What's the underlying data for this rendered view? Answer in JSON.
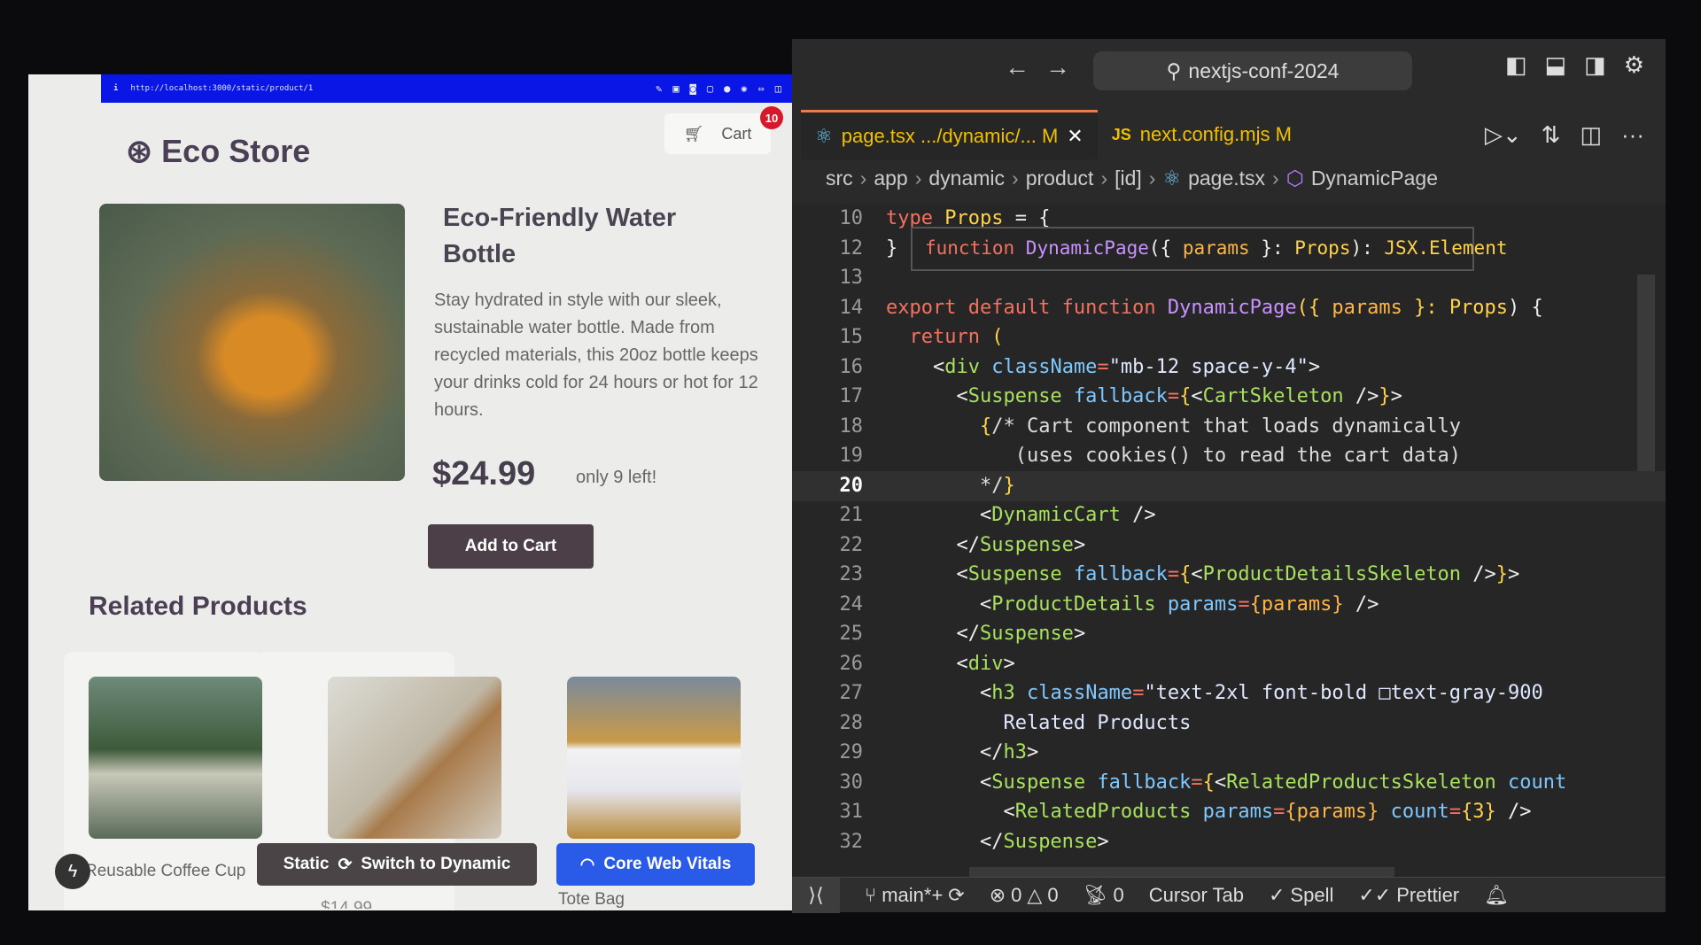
{
  "browser": {
    "url": "http://localhost:3000/static/product/1",
    "toolbar_icons": [
      "pin-icon",
      "contacts-icon",
      "camera-icon",
      "window-icon",
      "globe-icon",
      "settings-icon",
      "sync-icon",
      "sidebar-icon"
    ],
    "store_name": "Eco Store",
    "cart_label": "Cart",
    "cart_count": "10",
    "product": {
      "title": "Eco-Friendly Water Bottle",
      "description": "Stay hydrated in style with our sleek, sustainable water bottle. Made from recycled materials, this 20oz bottle keeps your drinks cold for 24 hours or hot for 12 hours.",
      "price": "$24.99",
      "stock": "only 9 left!",
      "add_to_cart": "Add to Cart"
    },
    "related_title": "Related Products",
    "related": [
      {
        "name": "Reusable Coffee Cup"
      },
      {
        "name": "",
        "price": "$14.99"
      },
      {
        "name": "Tote Bag"
      }
    ],
    "dev_tools": {
      "mode": "Static",
      "switch_label": "Switch to Dynamic",
      "vitals_label": "Core Web Vitals"
    },
    "colors": {
      "url_bar": "#0a16e6",
      "badge": "#d7182a",
      "vitals": "#2a5be8"
    }
  },
  "editor": {
    "search": "nextjs-conf-2024",
    "tabs": [
      {
        "label": "page.tsx .../dynamic/... M",
        "icon": "react-icon",
        "active": true
      },
      {
        "label": "next.config.mjs M",
        "icon": "js-icon",
        "active": false
      }
    ],
    "breadcrumb": [
      "src",
      "app",
      "dynamic",
      "product",
      "[id]",
      "page.tsx",
      "DynamicPage"
    ],
    "hover": [
      [
        "function ",
        "kw"
      ],
      [
        "DynamicPage",
        "fn"
      ],
      [
        "({ ",
        "pn"
      ],
      [
        "params",
        "pr"
      ],
      [
        " }: ",
        "pn"
      ],
      [
        "Props",
        "ty"
      ],
      [
        "): ",
        "pn"
      ],
      [
        "JSX.Element",
        "ty"
      ]
    ],
    "lines": [
      {
        "n": "10",
        "t": [
          [
            "type ",
            "kw"
          ],
          [
            "Props ",
            "ty"
          ],
          [
            "= {",
            "pn"
          ]
        ]
      },
      {
        "n": "12",
        "t": [
          [
            "}",
            "pn"
          ]
        ]
      },
      {
        "n": "13",
        "t": []
      },
      {
        "n": "14",
        "t": [
          [
            "export default function ",
            "kw"
          ],
          [
            "DynamicPage",
            "fn"
          ],
          [
            "({ ",
            "br"
          ],
          [
            "params",
            "pr"
          ],
          [
            " }: ",
            "br"
          ],
          [
            "Props",
            "ty"
          ],
          [
            ") {",
            "pn"
          ]
        ]
      },
      {
        "n": "15",
        "t": [
          [
            "  return ",
            "kw"
          ],
          [
            "(",
            "br"
          ]
        ]
      },
      {
        "n": "16",
        "t": [
          [
            "    <",
            "pn"
          ],
          [
            "div ",
            "tag"
          ],
          [
            "className",
            "at"
          ],
          [
            "=",
            "kw"
          ],
          [
            "\"mb-12 space-y-4\"",
            "str"
          ],
          [
            ">",
            "pn"
          ]
        ]
      },
      {
        "n": "17",
        "t": [
          [
            "      <",
            "pn"
          ],
          [
            "Suspense ",
            "tag"
          ],
          [
            "fallback",
            "at"
          ],
          [
            "=",
            "kw"
          ],
          [
            "{",
            "br"
          ],
          [
            "<",
            "pn"
          ],
          [
            "CartSkeleton ",
            "tag"
          ],
          [
            "/>",
            "pn"
          ],
          [
            "}",
            "br"
          ],
          [
            ">",
            "pn"
          ]
        ]
      },
      {
        "n": "18",
        "t": [
          [
            "        {",
            "br"
          ],
          [
            "/* Cart component that loads dynamically",
            "cm"
          ]
        ]
      },
      {
        "n": "19",
        "t": [
          [
            "           (uses cookies() to read the cart data)",
            "cm"
          ]
        ]
      },
      {
        "n": "20",
        "t": [
          [
            "        */",
            "cm"
          ],
          [
            "}",
            "br"
          ]
        ],
        "current": true
      },
      {
        "n": "21",
        "t": [
          [
            "        <",
            "pn"
          ],
          [
            "DynamicCart ",
            "tag"
          ],
          [
            "/>",
            "pn"
          ]
        ]
      },
      {
        "n": "22",
        "t": [
          [
            "      </",
            "pn"
          ],
          [
            "Suspense",
            "tag"
          ],
          [
            ">",
            "pn"
          ]
        ]
      },
      {
        "n": "23",
        "t": [
          [
            "      <",
            "pn"
          ],
          [
            "Suspense ",
            "tag"
          ],
          [
            "fallback",
            "at"
          ],
          [
            "=",
            "kw"
          ],
          [
            "{",
            "br"
          ],
          [
            "<",
            "pn"
          ],
          [
            "ProductDetailsSkeleton ",
            "tag"
          ],
          [
            "/>",
            "pn"
          ],
          [
            "}",
            "br"
          ],
          [
            ">",
            "pn"
          ]
        ]
      },
      {
        "n": "24",
        "t": [
          [
            "        <",
            "pn"
          ],
          [
            "ProductDetails ",
            "tag"
          ],
          [
            "params",
            "at"
          ],
          [
            "=",
            "kw"
          ],
          [
            "{params}",
            "pr"
          ],
          [
            " />",
            "pn"
          ]
        ]
      },
      {
        "n": "25",
        "t": [
          [
            "      </",
            "pn"
          ],
          [
            "Suspense",
            "tag"
          ],
          [
            ">",
            "pn"
          ]
        ]
      },
      {
        "n": "26",
        "t": [
          [
            "      <",
            "pn"
          ],
          [
            "div",
            "tag"
          ],
          [
            ">",
            "pn"
          ]
        ]
      },
      {
        "n": "27",
        "t": [
          [
            "        <",
            "pn"
          ],
          [
            "h3 ",
            "tag"
          ],
          [
            "className",
            "at"
          ],
          [
            "=",
            "kw"
          ],
          [
            "\"text-2xl font-bold □text-gray-900",
            "str"
          ]
        ]
      },
      {
        "n": "28",
        "t": [
          [
            "          Related Products",
            "str"
          ]
        ]
      },
      {
        "n": "29",
        "t": [
          [
            "        </",
            "pn"
          ],
          [
            "h3",
            "tag"
          ],
          [
            ">",
            "pn"
          ]
        ]
      },
      {
        "n": "30",
        "t": [
          [
            "        <",
            "pn"
          ],
          [
            "Suspense ",
            "tag"
          ],
          [
            "fallback",
            "at"
          ],
          [
            "=",
            "kw"
          ],
          [
            "{",
            "br"
          ],
          [
            "<",
            "pn"
          ],
          [
            "RelatedProductsSkeleton ",
            "tag"
          ],
          [
            "count",
            "at"
          ]
        ]
      },
      {
        "n": "31",
        "t": [
          [
            "          <",
            "pn"
          ],
          [
            "RelatedProducts ",
            "tag"
          ],
          [
            "params",
            "at"
          ],
          [
            "=",
            "kw"
          ],
          [
            "{params}",
            "pr"
          ],
          [
            " count",
            "at"
          ],
          [
            "=",
            "kw"
          ],
          [
            "{3}",
            "br"
          ],
          [
            " />",
            "pn"
          ]
        ]
      },
      {
        "n": "32",
        "t": [
          [
            "        </",
            "pn"
          ],
          [
            "Suspense",
            "tag"
          ],
          [
            ">",
            "pn"
          ]
        ]
      }
    ],
    "status": {
      "branch": "main*+",
      "errors": "0",
      "warnings": "0",
      "ports": "0",
      "cursor_tab": "Cursor Tab",
      "spell": "Spell",
      "prettier": "Prettier"
    }
  }
}
